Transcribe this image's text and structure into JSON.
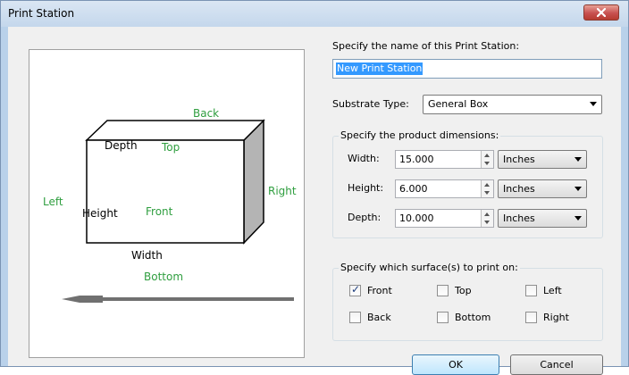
{
  "window": {
    "title": "Print Station"
  },
  "diagram": {
    "labels": {
      "back": "Back",
      "top": "Top",
      "depth": "Depth",
      "left": "Left",
      "right": "Right",
      "height": "Height",
      "front": "Front",
      "width": "Width",
      "bottom": "Bottom"
    }
  },
  "name": {
    "label": "Specify the name of this Print Station:",
    "value": "New Print Station"
  },
  "substrate": {
    "label": "Substrate Type:",
    "selected": "General Box"
  },
  "dimensions": {
    "group_title": "Specify the product dimensions:",
    "rows": [
      {
        "label": "Width:",
        "value": "15.000",
        "unit": "Inches"
      },
      {
        "label": "Height:",
        "value": "6.000",
        "unit": "Inches"
      },
      {
        "label": "Depth:",
        "value": "10.000",
        "unit": "Inches"
      }
    ]
  },
  "surfaces": {
    "group_title": "Specify which surface(s) to print on:",
    "options": [
      {
        "label": "Front",
        "checked": true
      },
      {
        "label": "Top",
        "checked": false
      },
      {
        "label": "Left",
        "checked": false
      },
      {
        "label": "Back",
        "checked": false
      },
      {
        "label": "Bottom",
        "checked": false
      },
      {
        "label": "Right",
        "checked": false
      }
    ]
  },
  "buttons": {
    "ok": "OK",
    "cancel": "Cancel"
  },
  "colors": {
    "label_green": "#2f9e3f",
    "selection_blue": "#3399ff",
    "close_red": "#c75050"
  }
}
